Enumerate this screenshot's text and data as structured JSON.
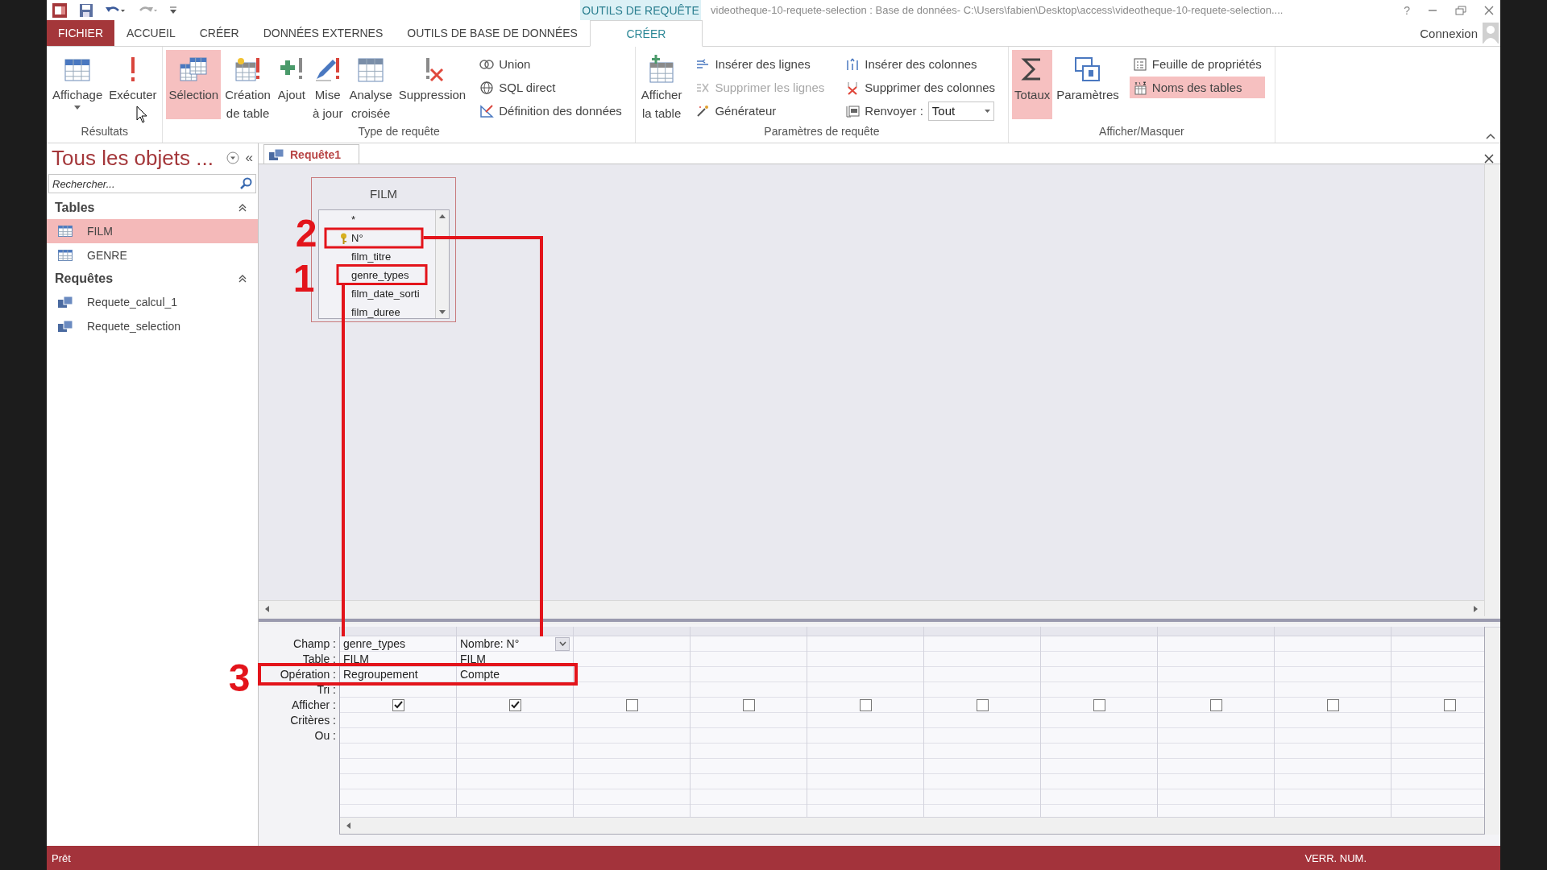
{
  "title_bar": {
    "contextual_label": "OUTILS DE REQUÊTE",
    "title": "videotheque-10-requete-selection : Base de données- C:\\Users\\fabien\\Desktop\\access\\videotheque-10-requete-selection....",
    "help": "?"
  },
  "ribbon_tabs": [
    {
      "label": "FICHIER",
      "kind": "file",
      "selected": false
    },
    {
      "label": "ACCUEIL",
      "kind": "normal",
      "selected": false
    },
    {
      "label": "CRÉER",
      "kind": "normal",
      "selected": false
    },
    {
      "label": "DONNÉES EXTERNES",
      "kind": "normal",
      "selected": false
    },
    {
      "label": "OUTILS DE BASE DE DONNÉES",
      "kind": "normal",
      "selected": false
    },
    {
      "label": "CRÉER",
      "kind": "contextual",
      "selected": true
    }
  ],
  "account": {
    "label": "Connexion"
  },
  "ribbon_groups": [
    {
      "label": "Résultats",
      "items": [
        {
          "kind": "large",
          "lines": [
            "Affichage"
          ],
          "dropdown": true,
          "selected": false
        },
        {
          "kind": "large",
          "lines": [
            "Exécuter"
          ],
          "dropdown": false,
          "selected": false
        }
      ]
    },
    {
      "label": "Type de requête",
      "items": [
        {
          "kind": "large",
          "lines": [
            "Sélection"
          ],
          "dropdown": false,
          "selected": true
        },
        {
          "kind": "large",
          "lines": [
            "Création",
            "de table"
          ],
          "dropdown": false,
          "selected": false
        },
        {
          "kind": "large",
          "lines": [
            "Ajout"
          ],
          "dropdown": false,
          "selected": false
        },
        {
          "kind": "large",
          "lines": [
            "Mise",
            "à jour"
          ],
          "dropdown": false,
          "selected": false
        },
        {
          "kind": "large",
          "lines": [
            "Analyse",
            "croisée"
          ],
          "dropdown": false,
          "selected": false
        },
        {
          "kind": "large",
          "lines": [
            "Suppression"
          ],
          "dropdown": false,
          "selected": false
        },
        {
          "kind": "stack",
          "items": [
            {
              "kind": "small",
              "label": "Union",
              "selected": false,
              "disabled": false
            },
            {
              "kind": "small",
              "label": "SQL direct",
              "selected": false,
              "disabled": false
            },
            {
              "kind": "small",
              "label": "Définition des données",
              "selected": false,
              "disabled": false
            }
          ]
        }
      ]
    },
    {
      "label": "Paramètres de requête",
      "items": [
        {
          "kind": "large",
          "lines": [
            "Afficher",
            "la table"
          ],
          "dropdown": false,
          "selected": false
        },
        {
          "kind": "stack",
          "items": [
            {
              "kind": "small",
              "label": "Insérer des lignes",
              "selected": false,
              "disabled": false
            },
            {
              "kind": "small",
              "label": "Supprimer les lignes",
              "selected": false,
              "disabled": true
            },
            {
              "kind": "small",
              "label": "Générateur",
              "selected": false,
              "disabled": false
            }
          ]
        },
        {
          "kind": "stack",
          "items": [
            {
              "kind": "small",
              "label": "Insérer des colonnes",
              "selected": false,
              "disabled": false
            },
            {
              "kind": "small",
              "label": "Supprimer des colonnes",
              "selected": false,
              "disabled": false
            },
            {
              "kind": "combo",
              "label": "Renvoyer :",
              "value": "Tout"
            }
          ]
        }
      ]
    },
    {
      "label": "Afficher/Masquer",
      "items": [
        {
          "kind": "large",
          "lines": [
            "Totaux"
          ],
          "dropdown": false,
          "selected": true
        },
        {
          "kind": "large",
          "lines": [
            "Paramètres"
          ],
          "dropdown": false,
          "selected": false
        },
        {
          "kind": "stack",
          "items": [
            {
              "kind": "small",
              "label": "Feuille de propriétés",
              "selected": false,
              "disabled": false
            },
            {
              "kind": "small",
              "label": "Noms des tables",
              "selected": true,
              "disabled": false
            }
          ]
        }
      ]
    }
  ],
  "nav": {
    "title": "Tous les objets ...",
    "collapse": "«",
    "search": {
      "placeholder": "Rechercher..."
    },
    "groups": [
      {
        "label": "Tables",
        "expanded": true,
        "items": [
          {
            "label": "FILM",
            "kind": "table",
            "selected": true
          },
          {
            "label": "GENRE",
            "kind": "table",
            "selected": false
          }
        ]
      },
      {
        "label": "Requêtes",
        "expanded": true,
        "items": [
          {
            "label": "Requete_calcul_1",
            "kind": "query",
            "selected": false
          },
          {
            "label": "Requete_selection",
            "kind": "query",
            "selected": false
          }
        ]
      }
    ]
  },
  "document": {
    "tabs": [
      {
        "label": "Requête1",
        "selected": true
      }
    ],
    "tables": [
      {
        "name": "FILM",
        "fields": [
          {
            "label": "*",
            "primary_key": false
          },
          {
            "label": "N°",
            "primary_key": true
          },
          {
            "label": "film_titre",
            "primary_key": false
          },
          {
            "label": "genre_types",
            "primary_key": false
          },
          {
            "label": "film_date_sorti",
            "primary_key": false
          },
          {
            "label": "film_duree",
            "primary_key": false
          }
        ]
      }
    ],
    "grid": {
      "row_labels": [
        "Champ :",
        "Table :",
        "Opération :",
        "Tri :",
        "Afficher :",
        "Critères :",
        "Ou :"
      ],
      "columns": [
        {
          "field": "genre_types",
          "table": "FILM",
          "operation": "Regroupement",
          "show": true,
          "dropdown": false
        },
        {
          "field": "Nombre: N°",
          "table": "FILM",
          "operation": "Compte",
          "show": true,
          "dropdown": true
        },
        {
          "show": false
        },
        {
          "show": false
        },
        {
          "show": false
        },
        {
          "show": false
        },
        {
          "show": false
        },
        {
          "show": false
        },
        {
          "show": false
        },
        {
          "show": false
        }
      ]
    }
  },
  "annotations": [
    {
      "label": "2"
    },
    {
      "label": "1"
    },
    {
      "label": "3"
    }
  ],
  "status_bar": {
    "left": "Prêt",
    "right": "VERR. NUM."
  }
}
